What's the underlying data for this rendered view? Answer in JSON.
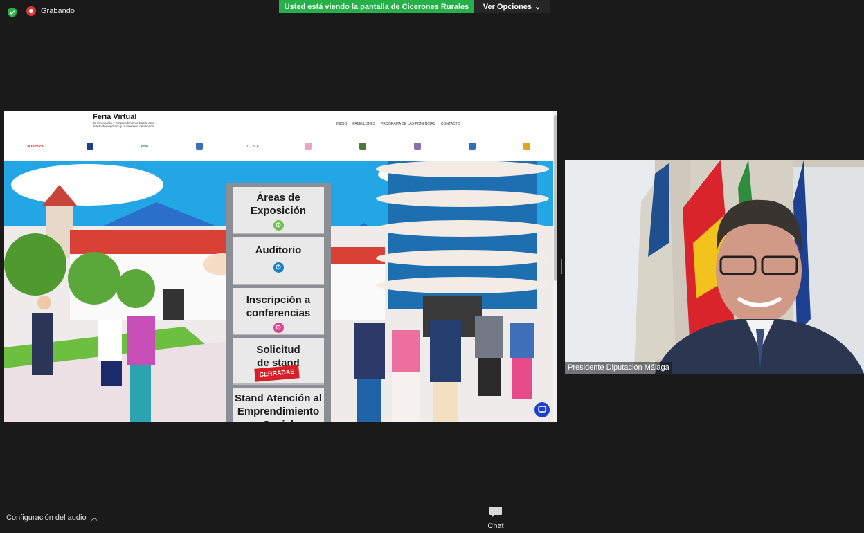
{
  "topbar": {
    "recording_label": "Grabando",
    "share_banner": "Usted está viendo la pantalla de Cicerones Rurales",
    "view_options": "Ver Opciones"
  },
  "shared_site": {
    "title": "Feria Virtual",
    "subtitle": "de Innovación y Emprendimiento Social ante el reto demográfico y la inversión de impacto",
    "nav": [
      "INICIO",
      "PABELLONES",
      "PROGRAMA DE LAS PONENCIAS",
      "CONTACTO"
    ],
    "sponsors": [
      "la térmica",
      "",
      "polo",
      "",
      "LINE",
      "",
      "",
      "",
      "",
      ""
    ],
    "signs": [
      {
        "label": "Áreas de Exposición",
        "dot_color": "#6cc24a"
      },
      {
        "label": "Auditorio",
        "dot_color": "#1a7fc0"
      },
      {
        "label": "Inscripción a conferencias",
        "dot_color": "#e2408d"
      },
      {
        "label": "Solicitud de stand",
        "badge": "CERRADAS"
      },
      {
        "label": "Stand Atención al Emprendimiento Social",
        "dot_color": "#1a5fc0"
      }
    ]
  },
  "video": {
    "participant_name": "Presidente Diputación Málaga"
  },
  "bottom": {
    "audio_config_label": "Configuración del audio",
    "chat_label": "Chat"
  },
  "colors": {
    "banner_green": "#27b04a",
    "record_red": "#d8363a",
    "zoom_bg": "#1a1a1a"
  }
}
